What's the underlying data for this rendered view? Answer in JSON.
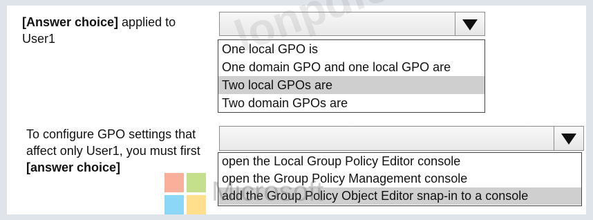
{
  "question1": {
    "label_bold": "[Answer choice]",
    "label_text": " applied to User1",
    "selected_value": "",
    "options": [
      "One local GPO is",
      "One domain GPO and one local GPO are",
      "Two local GPOs are",
      "Two domain GPOs are"
    ],
    "highlighted_option": "Two local GPOs are"
  },
  "question2": {
    "label_text": "To configure GPO settings that affect only User1, you must first ",
    "label_bold": "[answer choice]",
    "selected_value": "",
    "options": [
      "open the Local Group Policy Editor console",
      "open the Group Policy Management console",
      "add the Group Policy Object Editor snap-in to a console"
    ],
    "highlighted_option": "add the Group Policy Object Editor snap-in to a console"
  },
  "watermark": {
    "site_text": "lonpdfs.com",
    "brand_text": "Microsoft",
    "logo_icon": "microsoft-logo-icon"
  },
  "colors": {
    "highlight": "#cfcfcf",
    "frame": "#dfe3ea"
  }
}
